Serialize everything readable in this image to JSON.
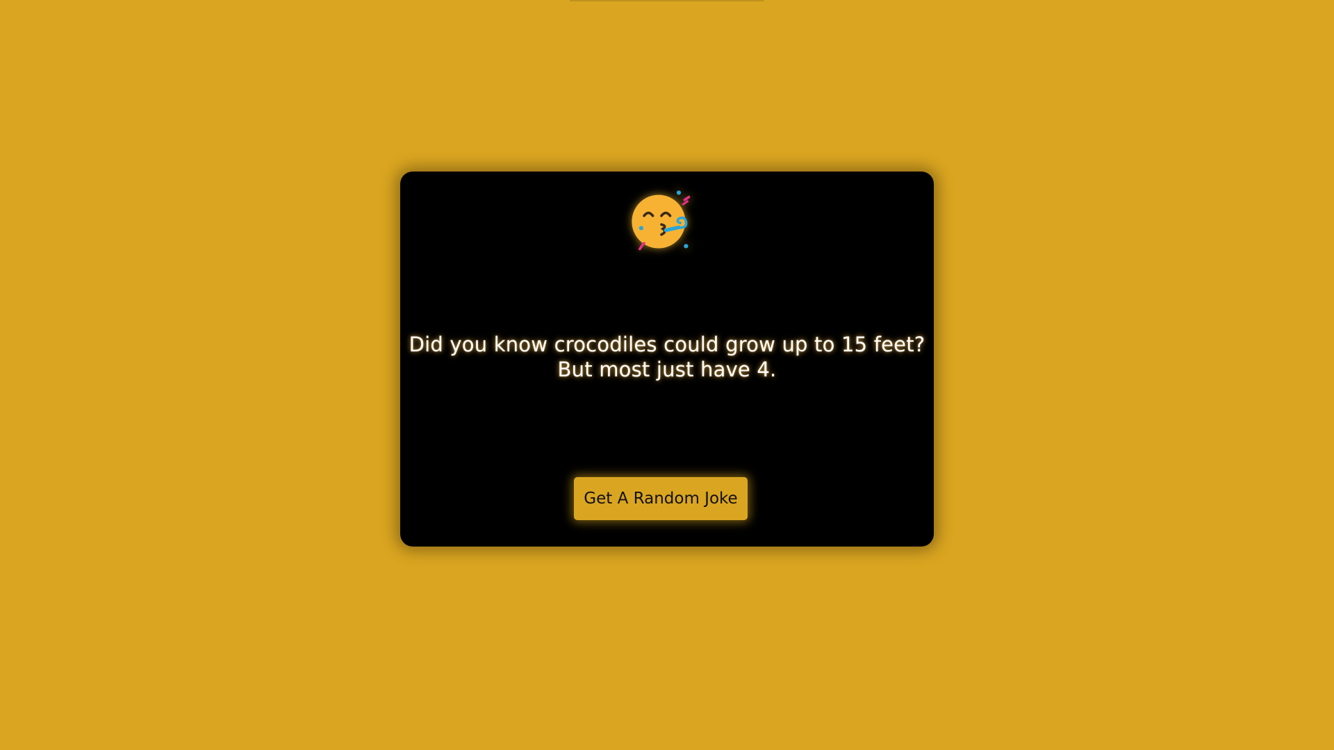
{
  "emoji": {
    "icon": "partying-face-icon"
  },
  "joke": {
    "line1": "Did you know crocodiles could grow up to 15 feet?",
    "line2": "But most just have 4."
  },
  "button": {
    "label": "Get A Random Joke"
  },
  "colors": {
    "background": "#DAA520",
    "card": "#000000",
    "button": "#DAA520",
    "text": "#FFFFFF"
  }
}
